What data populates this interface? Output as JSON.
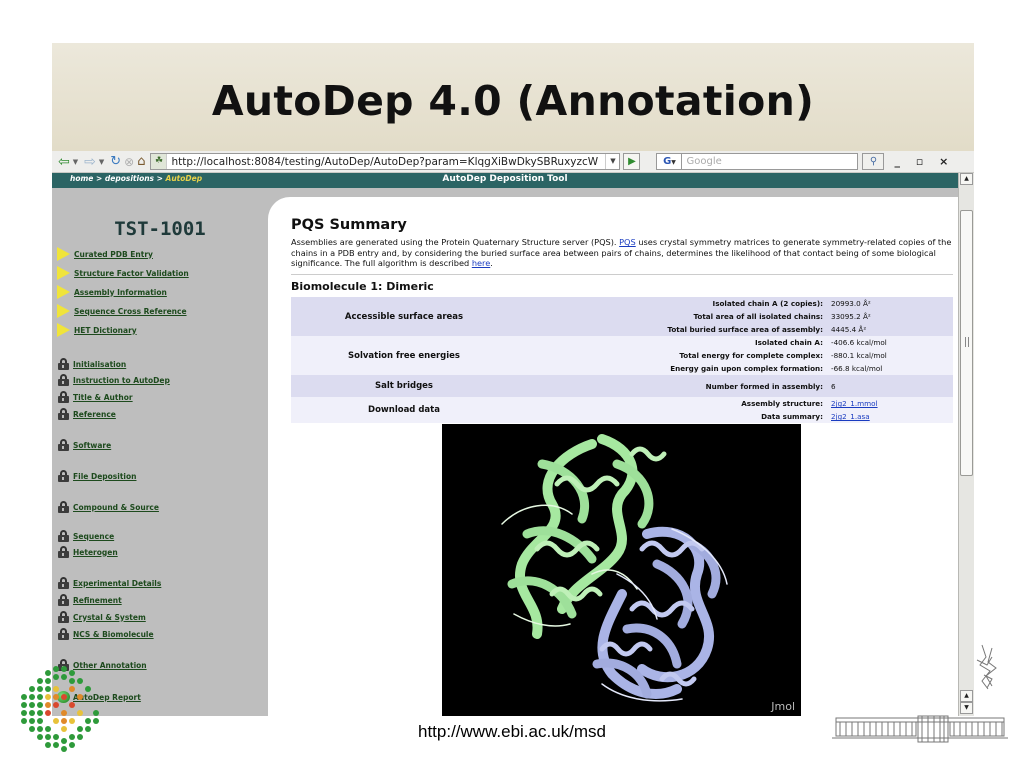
{
  "slide": {
    "title": "AutoDep 4.0 (Annotation)",
    "footer_url": "http://www.ebi.ac.uk/msd"
  },
  "browser": {
    "url": "http://localhost:8084/testing/AutoDep/AutoDep?param=KlqgXiBwDkySBRuxyzcW",
    "search_engine": "G",
    "search_placeholder": "Google",
    "window_controls": "_ ▫ ×"
  },
  "header": {
    "crumbs_prefix": "home > depositions > ",
    "crumbs_current": "AutoDep",
    "title": "AutoDep Deposition Tool"
  },
  "sidebar": {
    "deposition_id": "TST-1001",
    "items": [
      {
        "label": "Curated PDB Entry",
        "icon": "arrow-triangle-icon"
      },
      {
        "label": "Structure Factor Validation",
        "icon": "arrow-triangle-icon"
      },
      {
        "label": "Assembly Information",
        "icon": "arrow-triangle-icon"
      },
      {
        "label": "Sequence Cross Reference",
        "icon": "arrow-triangle-icon"
      },
      {
        "label": "HET Dictionary",
        "icon": "arrow-triangle-icon"
      },
      {
        "label": "Initialisation",
        "icon": "lock-icon"
      },
      {
        "label": "Instruction to AutoDep",
        "icon": "lock-icon"
      },
      {
        "label": "Title & Author",
        "icon": "lock-icon"
      },
      {
        "label": "Reference",
        "icon": "lock-icon"
      },
      {
        "label": "Software",
        "icon": "lock-icon"
      },
      {
        "label": "File Deposition",
        "icon": "lock-icon"
      },
      {
        "label": "Compound & Source",
        "icon": "lock-icon"
      },
      {
        "label": "Sequence",
        "icon": "lock-icon"
      },
      {
        "label": "Heterogen",
        "icon": "lock-icon"
      },
      {
        "label": "Experimental Details",
        "icon": "lock-icon"
      },
      {
        "label": "Refinement",
        "icon": "lock-icon"
      },
      {
        "label": "Crystal & System",
        "icon": "lock-icon"
      },
      {
        "label": "NCS & Biomolecule",
        "icon": "lock-icon"
      },
      {
        "label": "Other Annotation",
        "icon": "lock-icon"
      },
      {
        "label": "AutoDep Report",
        "icon": "green-ball-icon"
      }
    ]
  },
  "pqs": {
    "title": "PQS Summary",
    "desc_1": "Assemblies are generated using the Protein Quaternary Structure server (PQS). ",
    "desc_link1": "PQS",
    "desc_2": " uses crystal symmetry matrices to generate symmetry-related copies of the chains in a PDB entry and, by considering the buried surface area between pairs of chains, determines the likelihood of that contact being of some biological significance. The full algorithm is described ",
    "desc_link2": "here",
    "desc_3": ".",
    "biomolecule_title": "Biomolecule 1: Dimeric",
    "groups": [
      {
        "name": "Accessible surface areas",
        "rows": [
          {
            "label": "Isolated chain A (2 copies):",
            "value": "20993.0 Å²"
          },
          {
            "label": "Total area of all isolated chains:",
            "value": "33095.2 Å²"
          },
          {
            "label": "Total buried surface area of assembly:",
            "value": "4445.4 Å²"
          }
        ]
      },
      {
        "name": "Solvation free energies",
        "rows": [
          {
            "label": "Isolated chain A:",
            "value": "-406.6 kcal/mol"
          },
          {
            "label": "Total energy for complete complex:",
            "value": "-880.1 kcal/mol"
          },
          {
            "label": "Energy gain upon complex formation:",
            "value": "-66.8 kcal/mol"
          }
        ]
      },
      {
        "name": "Salt bridges",
        "rows": [
          {
            "label": "Number formed in assembly:",
            "value": "6"
          }
        ]
      },
      {
        "name": "Download data",
        "rows": [
          {
            "label": "Assembly structure:",
            "value": "2jg2_1.mmol"
          },
          {
            "label": "Data summary:",
            "value": "2jg2_1.asa"
          }
        ]
      }
    ]
  },
  "jmol": {
    "label": "Jmol",
    "chain_colors": [
      "#a6e8a0",
      "#aab4e6"
    ]
  }
}
